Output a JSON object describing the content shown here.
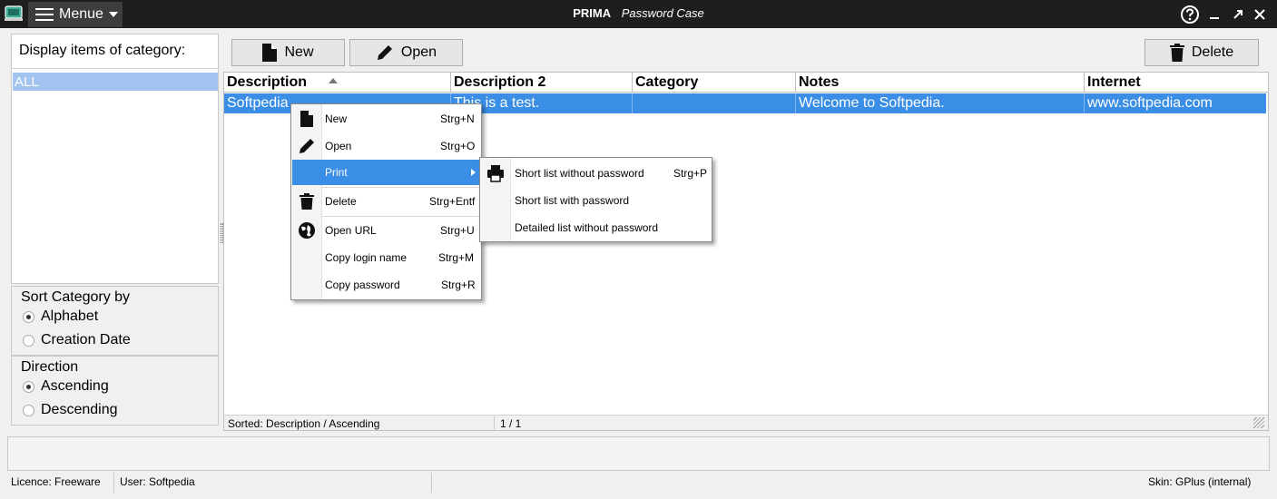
{
  "titlebar": {
    "menu_label": "Menue",
    "app_name": "PRIMA",
    "app_subtitle": "Password Case"
  },
  "category_panel": {
    "header": "Display items of category:",
    "items": [
      "ALL"
    ]
  },
  "sort_group": {
    "title": "Sort Category by",
    "options": [
      "Alphabet",
      "Creation Date"
    ],
    "selected": "Alphabet"
  },
  "direction_group": {
    "title": "Direction",
    "options": [
      "Ascending",
      "Descending"
    ],
    "selected": "Ascending"
  },
  "toolbar": {
    "new_label": "New",
    "open_label": "Open",
    "delete_label": "Delete"
  },
  "grid": {
    "columns": [
      "Description",
      "Description 2",
      "Category",
      "Notes",
      "Internet"
    ],
    "rows": [
      [
        "Softpedia",
        "This is a test.",
        "",
        "Welcome to Softpedia.",
        "www.softpedia.com"
      ]
    ],
    "status_sorted": "Sorted: Description / Ascending",
    "status_count": "1 / 1"
  },
  "context_menu": {
    "items": [
      {
        "label": "New",
        "shortcut": "Strg+N",
        "icon": "file-icon"
      },
      {
        "label": "Open",
        "shortcut": "Strg+O",
        "icon": "pencil-icon"
      },
      {
        "label": "Print",
        "shortcut": "",
        "icon": "",
        "highlighted": true,
        "has_submenu": true
      },
      {
        "label": "Delete",
        "shortcut": "Strg+Entf",
        "icon": "trash-icon"
      },
      {
        "label": "Open URL",
        "shortcut": "Strg+U",
        "icon": "globe-icon"
      },
      {
        "label": "Copy login name",
        "shortcut": "Strg+M",
        "icon": ""
      },
      {
        "label": "Copy password",
        "shortcut": "Strg+R",
        "icon": ""
      }
    ]
  },
  "print_submenu": {
    "items": [
      {
        "label": "Short list without password",
        "shortcut": "Strg+P",
        "icon": "printer-icon"
      },
      {
        "label": "Short list with password",
        "shortcut": ""
      },
      {
        "label": "Detailed list without password",
        "shortcut": ""
      }
    ]
  },
  "statusbar": {
    "licence": "Licence: Freeware",
    "user": "User: Softpedia",
    "skin": "Skin: GPlus (internal)"
  },
  "colors": {
    "titlebar": "#1e1e1e",
    "selection": "#3a8ee6",
    "category_selection": "#a3c4f0"
  }
}
